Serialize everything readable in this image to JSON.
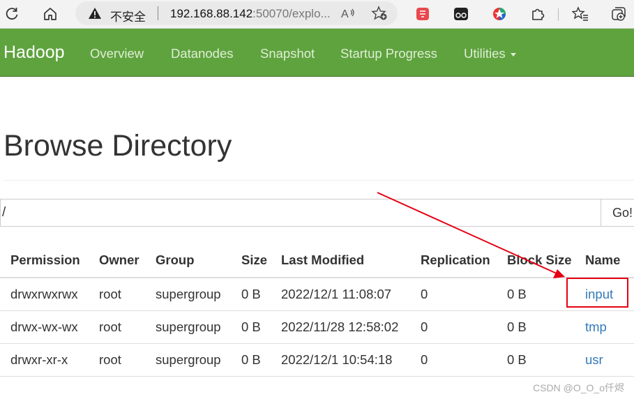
{
  "browser": {
    "security_label": "不安全",
    "url_host": "192.168.88.142",
    "url_rest": ":50070/explo...",
    "read_aloud": "A͘"
  },
  "navbar": {
    "brand": "Hadoop",
    "items": [
      {
        "label": "Overview"
      },
      {
        "label": "Datanodes"
      },
      {
        "label": "Snapshot"
      },
      {
        "label": "Startup Progress"
      },
      {
        "label": "Utilities"
      }
    ]
  },
  "page": {
    "title": "Browse Directory"
  },
  "path_bar": {
    "value": "/",
    "go_label": "Go!"
  },
  "table": {
    "headers": [
      "Permission",
      "Owner",
      "Group",
      "Size",
      "Last Modified",
      "Replication",
      "Block Size",
      "Name"
    ],
    "rows": [
      {
        "permission": "drwxrwxrwx",
        "owner": "root",
        "group": "supergroup",
        "size": "0 B",
        "modified": "2022/12/1 11:08:07",
        "replication": "0",
        "block_size": "0 B",
        "name": "input"
      },
      {
        "permission": "drwx-wx-wx",
        "owner": "root",
        "group": "supergroup",
        "size": "0 B",
        "modified": "2022/11/28 12:58:02",
        "replication": "0",
        "block_size": "0 B",
        "name": "tmp"
      },
      {
        "permission": "drwxr-xr-x",
        "owner": "root",
        "group": "supergroup",
        "size": "0 B",
        "modified": "2022/12/1 10:54:18",
        "replication": "0",
        "block_size": "0 B",
        "name": "usr"
      }
    ]
  },
  "watermark": "CSDN @O_O_o仟烬",
  "colors": {
    "navbar": "#5fa33e",
    "link": "#337ab7",
    "annotation": "#e60012"
  }
}
